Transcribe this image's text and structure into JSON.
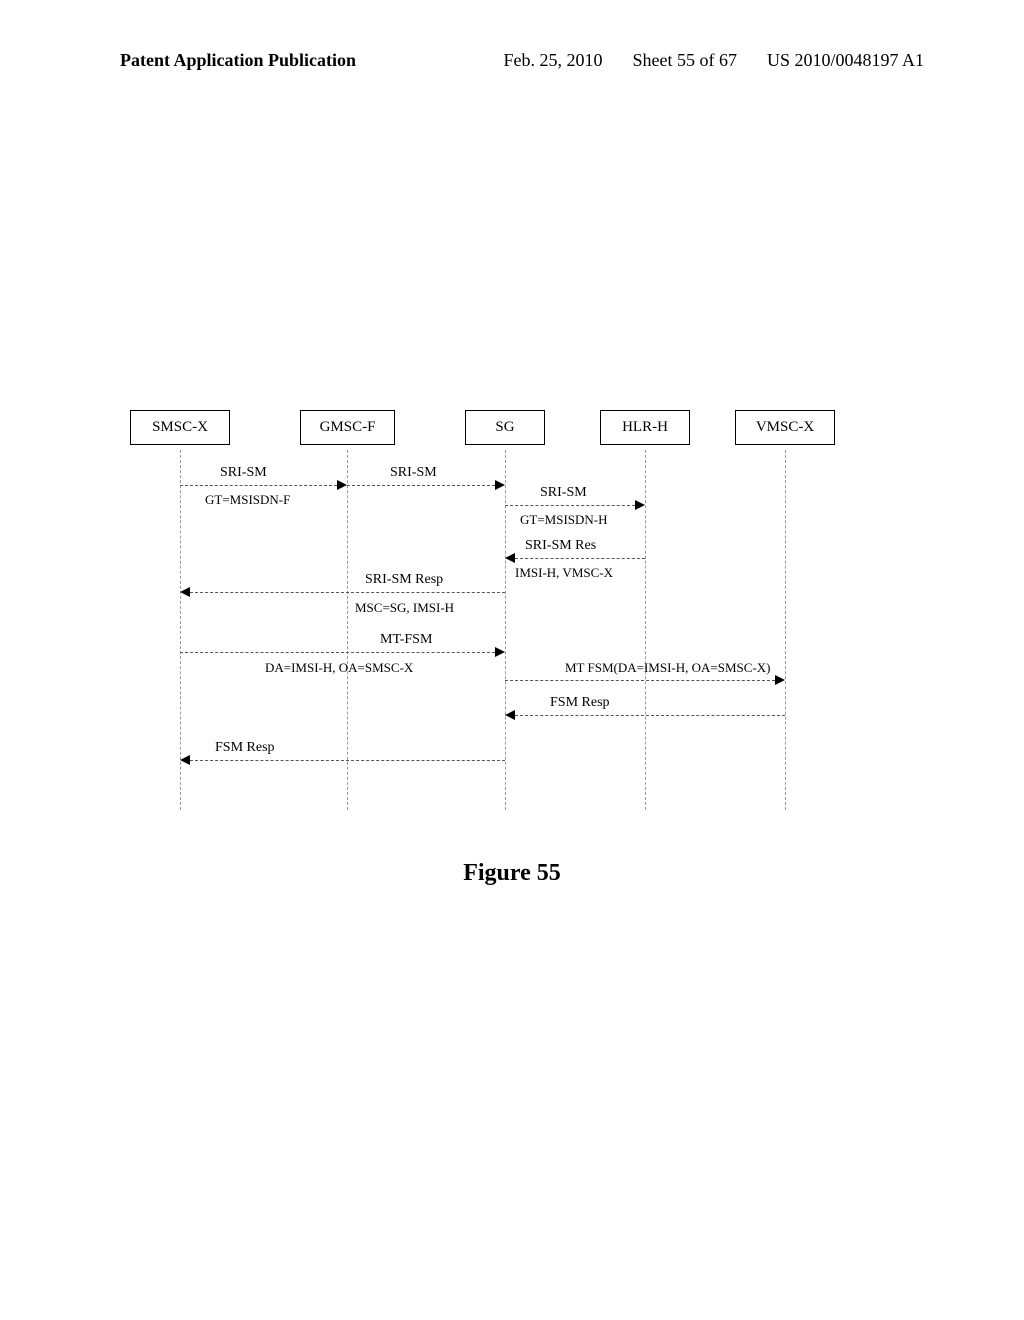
{
  "header": {
    "left": "Patent Application Publication",
    "date": "Feb. 25, 2010",
    "sheet": "Sheet 55 of 67",
    "pubno": "US 2010/0048197 A1"
  },
  "participants": {
    "p1": "SMSC-X",
    "p2": "GMSC-F",
    "p3": "SG",
    "p4": "HLR-H",
    "p5": "VMSC-X"
  },
  "messages": {
    "m1": "SRI-SM",
    "m1_sub": "GT=MSISDN-F",
    "m2": "SRI-SM",
    "m3": "SRI-SM",
    "m3_sub": "GT=MSISDN-H",
    "m4": "SRI-SM Res",
    "m4_sub": "IMSI-H, VMSC-X",
    "m5": "SRI-SM Resp",
    "m5_sub": "MSC=SG, IMSI-H",
    "m6": "MT-FSM",
    "m6_sub": "DA=IMSI-H, OA=SMSC-X",
    "m7": "MT FSM(DA=IMSI-H, OA=SMSC-X)",
    "m8": "FSM Resp",
    "m9": "FSM Resp"
  },
  "figure": "Figure 55",
  "chart_data": {
    "type": "sequence-diagram",
    "participants": [
      "SMSC-X",
      "GMSC-F",
      "SG",
      "HLR-H",
      "VMSC-X"
    ],
    "interactions": [
      {
        "from": "SMSC-X",
        "to": "GMSC-F",
        "label": "SRI-SM",
        "note": "GT=MSISDN-F"
      },
      {
        "from": "GMSC-F",
        "to": "SG",
        "label": "SRI-SM"
      },
      {
        "from": "SG",
        "to": "HLR-H",
        "label": "SRI-SM",
        "note": "GT=MSISDN-H"
      },
      {
        "from": "HLR-H",
        "to": "SG",
        "label": "SRI-SM Res",
        "note": "IMSI-H, VMSC-X"
      },
      {
        "from": "SG",
        "to": "SMSC-X",
        "label": "SRI-SM Resp",
        "note": "MSC=SG, IMSI-H"
      },
      {
        "from": "SMSC-X",
        "to": "SG",
        "label": "MT-FSM",
        "note": "DA=IMSI-H, OA=SMSC-X"
      },
      {
        "from": "SG",
        "to": "VMSC-X",
        "label": "MT FSM(DA=IMSI-H, OA=SMSC-X)"
      },
      {
        "from": "VMSC-X",
        "to": "SG",
        "label": "FSM Resp"
      },
      {
        "from": "SG",
        "to": "SMSC-X",
        "label": "FSM Resp"
      }
    ]
  }
}
